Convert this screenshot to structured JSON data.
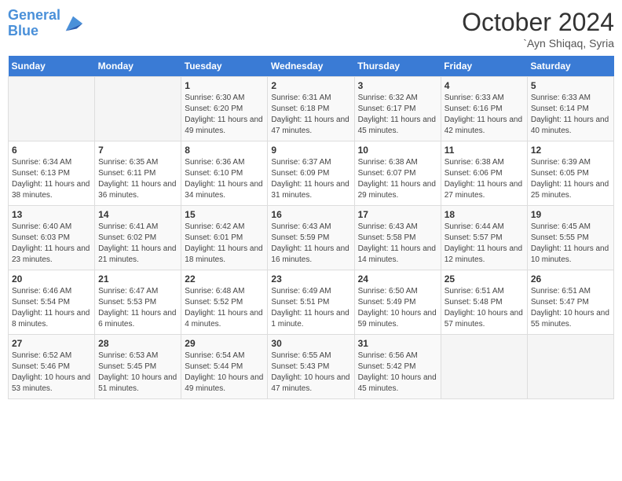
{
  "header": {
    "logo_line1": "General",
    "logo_line2": "Blue",
    "month": "October 2024",
    "location": "`Ayn Shiqaq, Syria"
  },
  "weekdays": [
    "Sunday",
    "Monday",
    "Tuesday",
    "Wednesday",
    "Thursday",
    "Friday",
    "Saturday"
  ],
  "weeks": [
    [
      {
        "day": "",
        "info": ""
      },
      {
        "day": "",
        "info": ""
      },
      {
        "day": "1",
        "info": "Sunrise: 6:30 AM\nSunset: 6:20 PM\nDaylight: 11 hours and 49 minutes."
      },
      {
        "day": "2",
        "info": "Sunrise: 6:31 AM\nSunset: 6:18 PM\nDaylight: 11 hours and 47 minutes."
      },
      {
        "day": "3",
        "info": "Sunrise: 6:32 AM\nSunset: 6:17 PM\nDaylight: 11 hours and 45 minutes."
      },
      {
        "day": "4",
        "info": "Sunrise: 6:33 AM\nSunset: 6:16 PM\nDaylight: 11 hours and 42 minutes."
      },
      {
        "day": "5",
        "info": "Sunrise: 6:33 AM\nSunset: 6:14 PM\nDaylight: 11 hours and 40 minutes."
      }
    ],
    [
      {
        "day": "6",
        "info": "Sunrise: 6:34 AM\nSunset: 6:13 PM\nDaylight: 11 hours and 38 minutes."
      },
      {
        "day": "7",
        "info": "Sunrise: 6:35 AM\nSunset: 6:11 PM\nDaylight: 11 hours and 36 minutes."
      },
      {
        "day": "8",
        "info": "Sunrise: 6:36 AM\nSunset: 6:10 PM\nDaylight: 11 hours and 34 minutes."
      },
      {
        "day": "9",
        "info": "Sunrise: 6:37 AM\nSunset: 6:09 PM\nDaylight: 11 hours and 31 minutes."
      },
      {
        "day": "10",
        "info": "Sunrise: 6:38 AM\nSunset: 6:07 PM\nDaylight: 11 hours and 29 minutes."
      },
      {
        "day": "11",
        "info": "Sunrise: 6:38 AM\nSunset: 6:06 PM\nDaylight: 11 hours and 27 minutes."
      },
      {
        "day": "12",
        "info": "Sunrise: 6:39 AM\nSunset: 6:05 PM\nDaylight: 11 hours and 25 minutes."
      }
    ],
    [
      {
        "day": "13",
        "info": "Sunrise: 6:40 AM\nSunset: 6:03 PM\nDaylight: 11 hours and 23 minutes."
      },
      {
        "day": "14",
        "info": "Sunrise: 6:41 AM\nSunset: 6:02 PM\nDaylight: 11 hours and 21 minutes."
      },
      {
        "day": "15",
        "info": "Sunrise: 6:42 AM\nSunset: 6:01 PM\nDaylight: 11 hours and 18 minutes."
      },
      {
        "day": "16",
        "info": "Sunrise: 6:43 AM\nSunset: 5:59 PM\nDaylight: 11 hours and 16 minutes."
      },
      {
        "day": "17",
        "info": "Sunrise: 6:43 AM\nSunset: 5:58 PM\nDaylight: 11 hours and 14 minutes."
      },
      {
        "day": "18",
        "info": "Sunrise: 6:44 AM\nSunset: 5:57 PM\nDaylight: 11 hours and 12 minutes."
      },
      {
        "day": "19",
        "info": "Sunrise: 6:45 AM\nSunset: 5:55 PM\nDaylight: 11 hours and 10 minutes."
      }
    ],
    [
      {
        "day": "20",
        "info": "Sunrise: 6:46 AM\nSunset: 5:54 PM\nDaylight: 11 hours and 8 minutes."
      },
      {
        "day": "21",
        "info": "Sunrise: 6:47 AM\nSunset: 5:53 PM\nDaylight: 11 hours and 6 minutes."
      },
      {
        "day": "22",
        "info": "Sunrise: 6:48 AM\nSunset: 5:52 PM\nDaylight: 11 hours and 4 minutes."
      },
      {
        "day": "23",
        "info": "Sunrise: 6:49 AM\nSunset: 5:51 PM\nDaylight: 11 hours and 1 minute."
      },
      {
        "day": "24",
        "info": "Sunrise: 6:50 AM\nSunset: 5:49 PM\nDaylight: 10 hours and 59 minutes."
      },
      {
        "day": "25",
        "info": "Sunrise: 6:51 AM\nSunset: 5:48 PM\nDaylight: 10 hours and 57 minutes."
      },
      {
        "day": "26",
        "info": "Sunrise: 6:51 AM\nSunset: 5:47 PM\nDaylight: 10 hours and 55 minutes."
      }
    ],
    [
      {
        "day": "27",
        "info": "Sunrise: 6:52 AM\nSunset: 5:46 PM\nDaylight: 10 hours and 53 minutes."
      },
      {
        "day": "28",
        "info": "Sunrise: 6:53 AM\nSunset: 5:45 PM\nDaylight: 10 hours and 51 minutes."
      },
      {
        "day": "29",
        "info": "Sunrise: 6:54 AM\nSunset: 5:44 PM\nDaylight: 10 hours and 49 minutes."
      },
      {
        "day": "30",
        "info": "Sunrise: 6:55 AM\nSunset: 5:43 PM\nDaylight: 10 hours and 47 minutes."
      },
      {
        "day": "31",
        "info": "Sunrise: 6:56 AM\nSunset: 5:42 PM\nDaylight: 10 hours and 45 minutes."
      },
      {
        "day": "",
        "info": ""
      },
      {
        "day": "",
        "info": ""
      }
    ]
  ]
}
